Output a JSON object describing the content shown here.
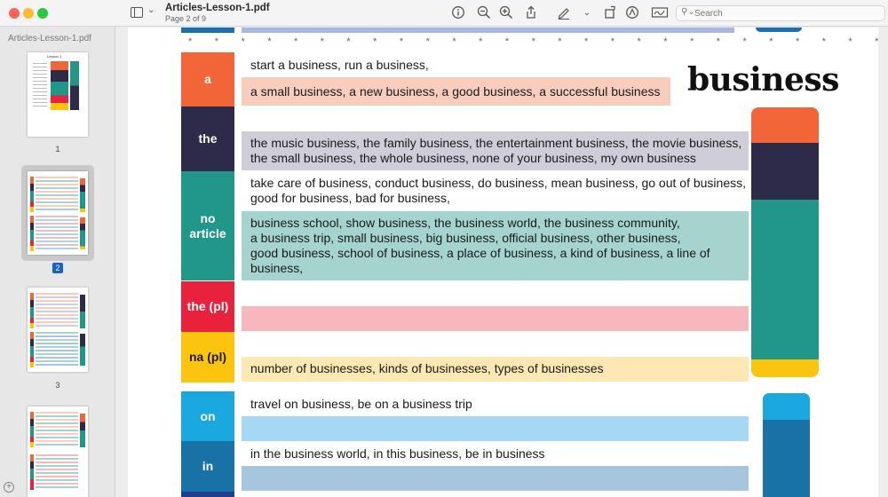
{
  "window": {
    "title": "Articles-Lesson-1.pdf",
    "subtitle": "Page 2 of 9"
  },
  "toolbar": {
    "icons": [
      "sidebar-icon",
      "chevron-down-icon",
      "info-icon",
      "zoom-out-icon",
      "zoom-in-icon",
      "share-icon",
      "markup-pen-icon",
      "chevron-down-icon",
      "rotate-icon",
      "annotate-icon",
      "signature-icon"
    ],
    "search_placeholder": "Search"
  },
  "sidebar": {
    "file_name": "Articles-Lesson-1.pdf",
    "thumb1_title": "Lesson 1",
    "pages": [
      {
        "label": "1"
      },
      {
        "label": "2",
        "selected": true
      },
      {
        "label": "3"
      }
    ]
  },
  "page": {
    "star_row": "* * * * * * * * * * * * * * * * * * * * * * * * * * * * * * * * * * * * * * * * * * * * * * * * * * * * * * *",
    "headword": "business",
    "rows": [
      {
        "label": "a",
        "color": "#f26538",
        "text1": "start a business, run a business,",
        "text2": "a small business, a new business, a good business, a successful business"
      },
      {
        "label": "the",
        "color": "#2d2a4a",
        "text1": "the music business, the family business, the entertainment business, the movie business,",
        "text2": "the small business, the whole business, none of your business, my own business"
      },
      {
        "label": "no article",
        "label_line1": "no",
        "label_line2": "article",
        "color": "#21978a",
        "text1": "take care of business, conduct business, do business, mean business, go out of business,",
        "text2": "good for business, bad for business,",
        "text3": "business school, show business, the business world, the business community,",
        "text4": "a business trip, small business, big business, official business, other business,",
        "text5": "good business, school of business, a place of business, a kind of business, a line of",
        "text6": "business,"
      },
      {
        "label": "the (pl)",
        "color": "#e8213d"
      },
      {
        "label": "na (pl)",
        "color": "#fcc50d",
        "text1": "number of businesses, kinds of businesses, types of businesses"
      },
      {
        "label": "on",
        "color": "#1ba8e0",
        "text1": "travel on business, be on a business trip"
      },
      {
        "label": "in",
        "color": "#1872a6",
        "text1": "in the business world, in this business, be in business"
      }
    ],
    "colors": {
      "a_light": "#f9cdbd",
      "the_light": "#cfcdd8",
      "no_article_light": "#a4d4cd",
      "the_pl_light": "#f8b7bd",
      "na_pl_light": "#fde8b3",
      "on_light": "#a5d8f3",
      "in_light": "#a6c6dd"
    }
  }
}
